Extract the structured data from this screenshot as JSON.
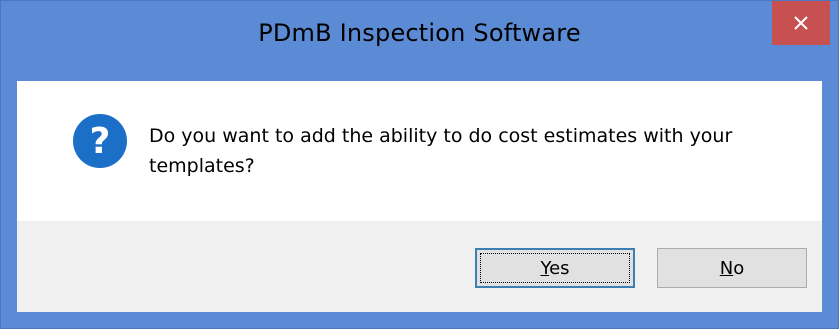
{
  "window": {
    "title": "PDmB Inspection Software",
    "close_icon": "close-icon"
  },
  "message": {
    "icon": "question-icon",
    "text": "Do you want to add the ability to do cost estimates with your templates?"
  },
  "buttons": {
    "yes": {
      "mnemonic": "Y",
      "rest": "es"
    },
    "no": {
      "mnemonic": "N",
      "rest": "o"
    }
  },
  "colors": {
    "titlebar": "#5b8bd4",
    "close": "#c75050",
    "icon": "#1c6fc7",
    "footer": "#f0f0f0"
  }
}
